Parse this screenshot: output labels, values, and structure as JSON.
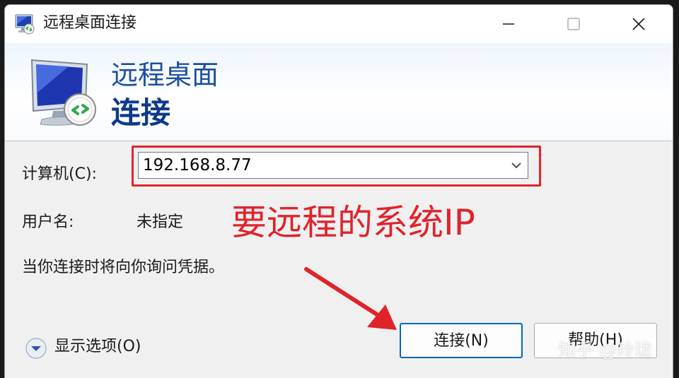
{
  "window": {
    "title": "远程桌面连接",
    "icon": "remote-desktop-icon",
    "controls": {
      "minimize": "minimize-icon",
      "maximize": "maximize-icon",
      "close": "close-icon"
    }
  },
  "banner": {
    "line1": "远程桌面",
    "line2": "连接",
    "icon": "monitor-icon"
  },
  "form": {
    "computer_label": "计算机(C):",
    "computer_value": "192.168.8.77",
    "username_label": "用户名:",
    "username_value": "未指定",
    "credentials_note": "当你连接时将向你询问凭据。"
  },
  "annotation": {
    "text": "要远程的系统IP",
    "color": "#e0232b"
  },
  "options": {
    "label": "显示选项(O)",
    "icon": "chevron-down-circle-icon"
  },
  "buttons": {
    "connect": "连接(N)",
    "help": "帮助(H)"
  },
  "watermark": "知乎 @玲珑",
  "colors": {
    "accent": "#0067c0",
    "banner_title": "#1d4fa0",
    "annotation_red": "#e0232b"
  }
}
